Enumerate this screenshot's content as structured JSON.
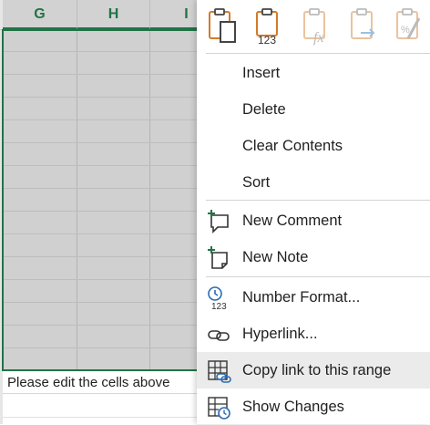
{
  "sheet": {
    "columns": [
      "G",
      "H",
      "I"
    ],
    "below_text": "Please edit the cells above"
  },
  "paste_options": [
    "paste-icon",
    "paste-values-icon",
    "paste-formulas-icon",
    "paste-link-icon",
    "paste-formatting-icon"
  ],
  "menu": {
    "insert": "Insert",
    "delete": "Delete",
    "clear_contents": "Clear Contents",
    "sort": "Sort",
    "new_comment": "New Comment",
    "new_note": "New Note",
    "number_format": "Number Format...",
    "hyperlink": "Hyperlink...",
    "copy_link": "Copy link to this range",
    "show_changes": "Show Changes"
  },
  "paste_badge": "123",
  "number_format_badge": "123",
  "colors": {
    "accent_green": "#217346",
    "icon_orange": "#d47a2a",
    "icon_blue": "#2b6cb0",
    "disabled_orange": "#eac39e",
    "hover_gray": "#ebebeb"
  }
}
